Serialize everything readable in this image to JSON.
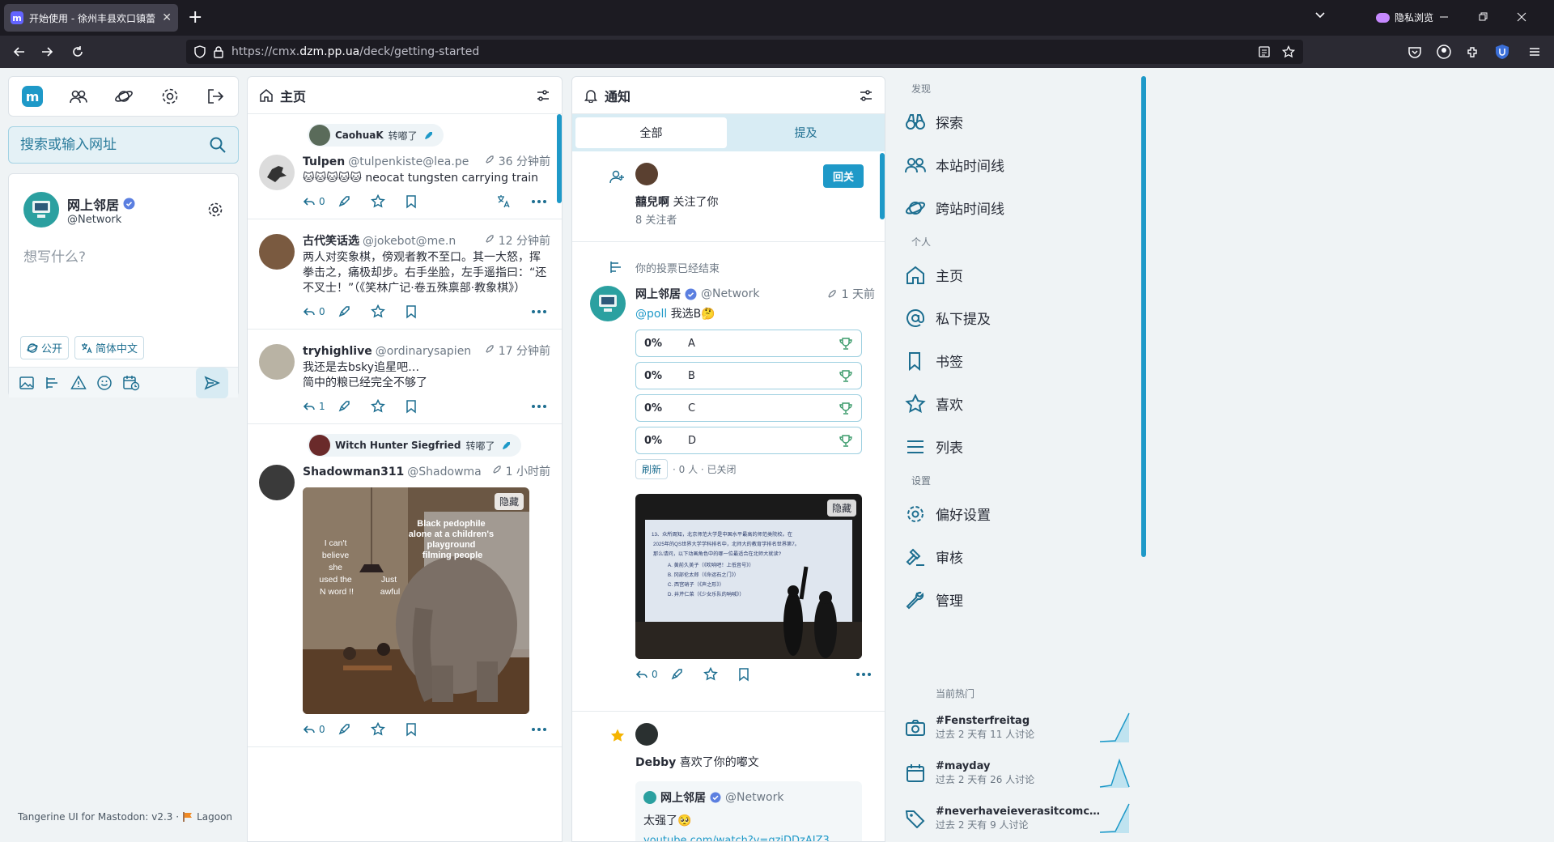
{
  "browser": {
    "tab_title": "开始使用 - 徐州丰县欢口镇蕾",
    "favicon": "m",
    "private_label": "隐私浏览",
    "url_prefix": "https://cmx.",
    "url_domain": "dzm.pp.ua",
    "url_path": "/deck/getting-started"
  },
  "compose": {
    "search_placeholder": "搜索或输入网址",
    "user_name": "网上邻居",
    "user_acct": "@Network",
    "placeholder": "想写什么?",
    "visibility": "公开",
    "language": "简体中文"
  },
  "footer": {
    "text": "Tangerine UI for Mastodon: v2.3 ·",
    "link": "Lagoon"
  },
  "home": {
    "title": "主页",
    "statuses": [
      {
        "boosted_by": "CaohuaK",
        "boost_suffix": "转嘟了",
        "name": "Tulpen",
        "acct": "@tulpenkiste@lea.pe",
        "time": "36 分钟前",
        "text": "🐱🐱🐱🐱🐱 neocat tungsten carrying train",
        "replies": "0",
        "has_translate": true
      },
      {
        "name": "古代笑话选",
        "acct": "@jokebot@me.n",
        "time": "12 分钟前",
        "text": "两人对奕象棋，傍观者教不至口。其一大怒，挥拳击之，痛极却步。右手坐脸，左手遥指曰：“还不叉士！”（《笑林广记·卷五殊禀部·教象棋》）",
        "replies": "0"
      },
      {
        "name": "tryhighlive",
        "acct": "@ordinarysapien",
        "time": "17 分钟前",
        "text": "我还是去bsky追星吧…\n简中的粮已经完全不够了",
        "replies": "1"
      },
      {
        "boosted_by": "Witch Hunter Siegfried",
        "boost_suffix": "转嘟了",
        "name": "Shadowman311",
        "acct": "@Shadowma",
        "time": "1 小时前",
        "replies": "0",
        "media": {
          "hide_label": "隐藏",
          "caption_top": "Black pedophile alone at a children's playground filming people",
          "caption_left": "I can't believe she used the N word !!",
          "caption_right": "Just awful"
        }
      }
    ]
  },
  "notifications": {
    "title": "通知",
    "tabs": [
      "全部",
      "提及"
    ],
    "follow": {
      "name": "囍兒啊",
      "action": "关注了你",
      "followers": "8 关注者",
      "button": "回关"
    },
    "poll": {
      "header": "你的投票已经结束",
      "name": "网上邻居",
      "acct": "@Network",
      "time": "1 天前",
      "mention": "@poll",
      "text": "我选B🤔",
      "options": [
        {
          "pct": "0%",
          "label": "A"
        },
        {
          "pct": "0%",
          "label": "B"
        },
        {
          "pct": "0%",
          "label": "C"
        },
        {
          "pct": "0%",
          "label": "D"
        }
      ],
      "refresh": "刷新",
      "meta": "· 0 人 · 已关闭",
      "hide_label": "隐藏",
      "slide_lines": [
        "13、众所周知，北京师范大学是中国水平最高的师范类院校。在",
        "2025年的QS世界大学学科排名中，北师大的教育学排名世界第7。",
        "那么请问，以下动画角色中的哪一位最适合在北师大就读?",
        "A. 黄前久美子（《吹响吧！上低音号》）",
        "B. 冈部伦太郎（《命运石之门》）",
        "C. 西宫硝子（《声之形》）",
        "D. 井芹仁菜（《少女乐队的呐喊》）"
      ],
      "replies": "0"
    },
    "fav": {
      "name": "Debby",
      "action": "喜欢了你的嘟文",
      "quote_name": "网上邻居",
      "quote_acct": "@Network",
      "quote_text": "太强了🥺",
      "quote_link": "youtube.com/watch?v=qziDDzAIZ3"
    }
  },
  "rightnav": {
    "section_discover": "发现",
    "discover": [
      "探索",
      "本站时间线",
      "跨站时间线"
    ],
    "section_personal": "个人",
    "personal": [
      "主页",
      "私下提及",
      "书签",
      "喜欢",
      "列表"
    ],
    "section_settings": "设置",
    "settings": [
      "偏好设置",
      "审核",
      "管理"
    ],
    "section_trending": "当前热门",
    "trends": [
      {
        "tag": "#Fensterfreitag",
        "sub": "过去 2 天有 11 人讨论"
      },
      {
        "tag": "#mayday",
        "sub": "过去 2 天有 26 人讨论"
      },
      {
        "tag": "#neverhaveieverasitcomcharac…",
        "sub": "过去 2 天有 9 人讨论"
      }
    ]
  },
  "colors": {
    "accent": "#1e99c8",
    "text": "#282c37",
    "bg": "#eff3f5"
  }
}
